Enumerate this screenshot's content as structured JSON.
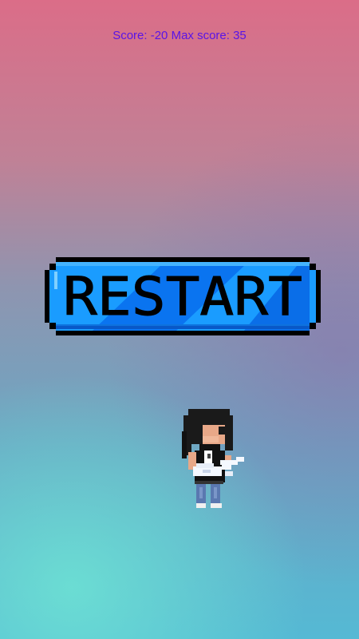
{
  "hud": {
    "score_text": "Score: -20 Max score: 35"
  },
  "restart_button": {
    "label": "RESTART"
  },
  "colors": {
    "score_text": "#5a14e6",
    "button_fill_light": "#1a9cff",
    "button_fill_dark": "#0a74f0",
    "button_outline": "#000000"
  },
  "icons": {
    "player": "guitarist-character-icon"
  }
}
